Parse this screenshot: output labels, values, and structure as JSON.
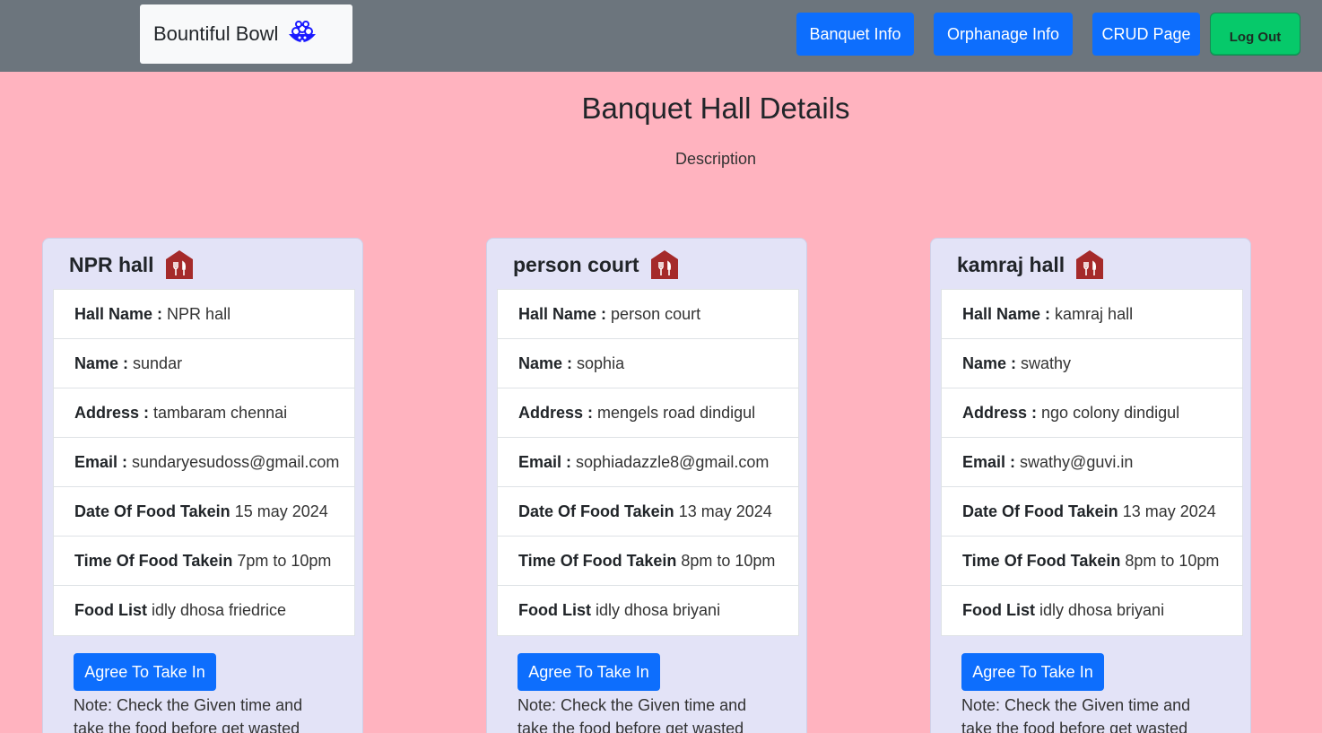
{
  "brand": {
    "name": "Bountiful Bowl",
    "icon": "bowl-icon"
  },
  "nav": {
    "banquet_info": "Banquet Info",
    "orphanage_info": "Orphanage Info",
    "crud_page": "CRUD Page",
    "log_out": "Log Out"
  },
  "colors": {
    "navbar": "#6c757d",
    "page_background": "#ffb3bf",
    "primary_button": "#0d6efd",
    "logout_button": "#06c96a",
    "card_background": "#e3e3f7",
    "hall_icon": "#a52a2a"
  },
  "page": {
    "title": "Banquet Hall Details",
    "description": "Description"
  },
  "labels": {
    "hall_name": "Hall Name :",
    "name": "Name :",
    "address": "Address :",
    "email": "Email :",
    "date": "Date Of Food Takein",
    "time": "Time Of Food Takein",
    "food_list": "Food List"
  },
  "cards": [
    {
      "title": "NPR hall",
      "hall_name": "NPR hall",
      "name": "sundar",
      "address": "tambaram chennai",
      "email": "sundaryesudoss@gmail.com",
      "date": "15 may 2024",
      "time": "7pm to 10pm",
      "food_list": "idly dhosa friedrice",
      "button": "Agree To Take In",
      "note": "Note: Check the Given time and take the food before get wasted"
    },
    {
      "title": "person court",
      "hall_name": "person court",
      "name": "sophia",
      "address": "mengels road dindigul",
      "email": "sophiadazzle8@gmail.com",
      "date": "13 may 2024",
      "time": "8pm to 10pm",
      "food_list": "idly dhosa briyani",
      "button": "Agree To Take In",
      "note": "Note: Check the Given time and take the food before get wasted"
    },
    {
      "title": "kamraj hall",
      "hall_name": "kamraj hall",
      "name": "swathy",
      "address": "ngo colony dindigul",
      "email": "swathy@guvi.in",
      "date": "13 may 2024",
      "time": "8pm to 10pm",
      "food_list": "idly dhosa briyani",
      "button": "Agree To Take In",
      "note": "Note: Check the Given time and take the food before get wasted"
    }
  ]
}
